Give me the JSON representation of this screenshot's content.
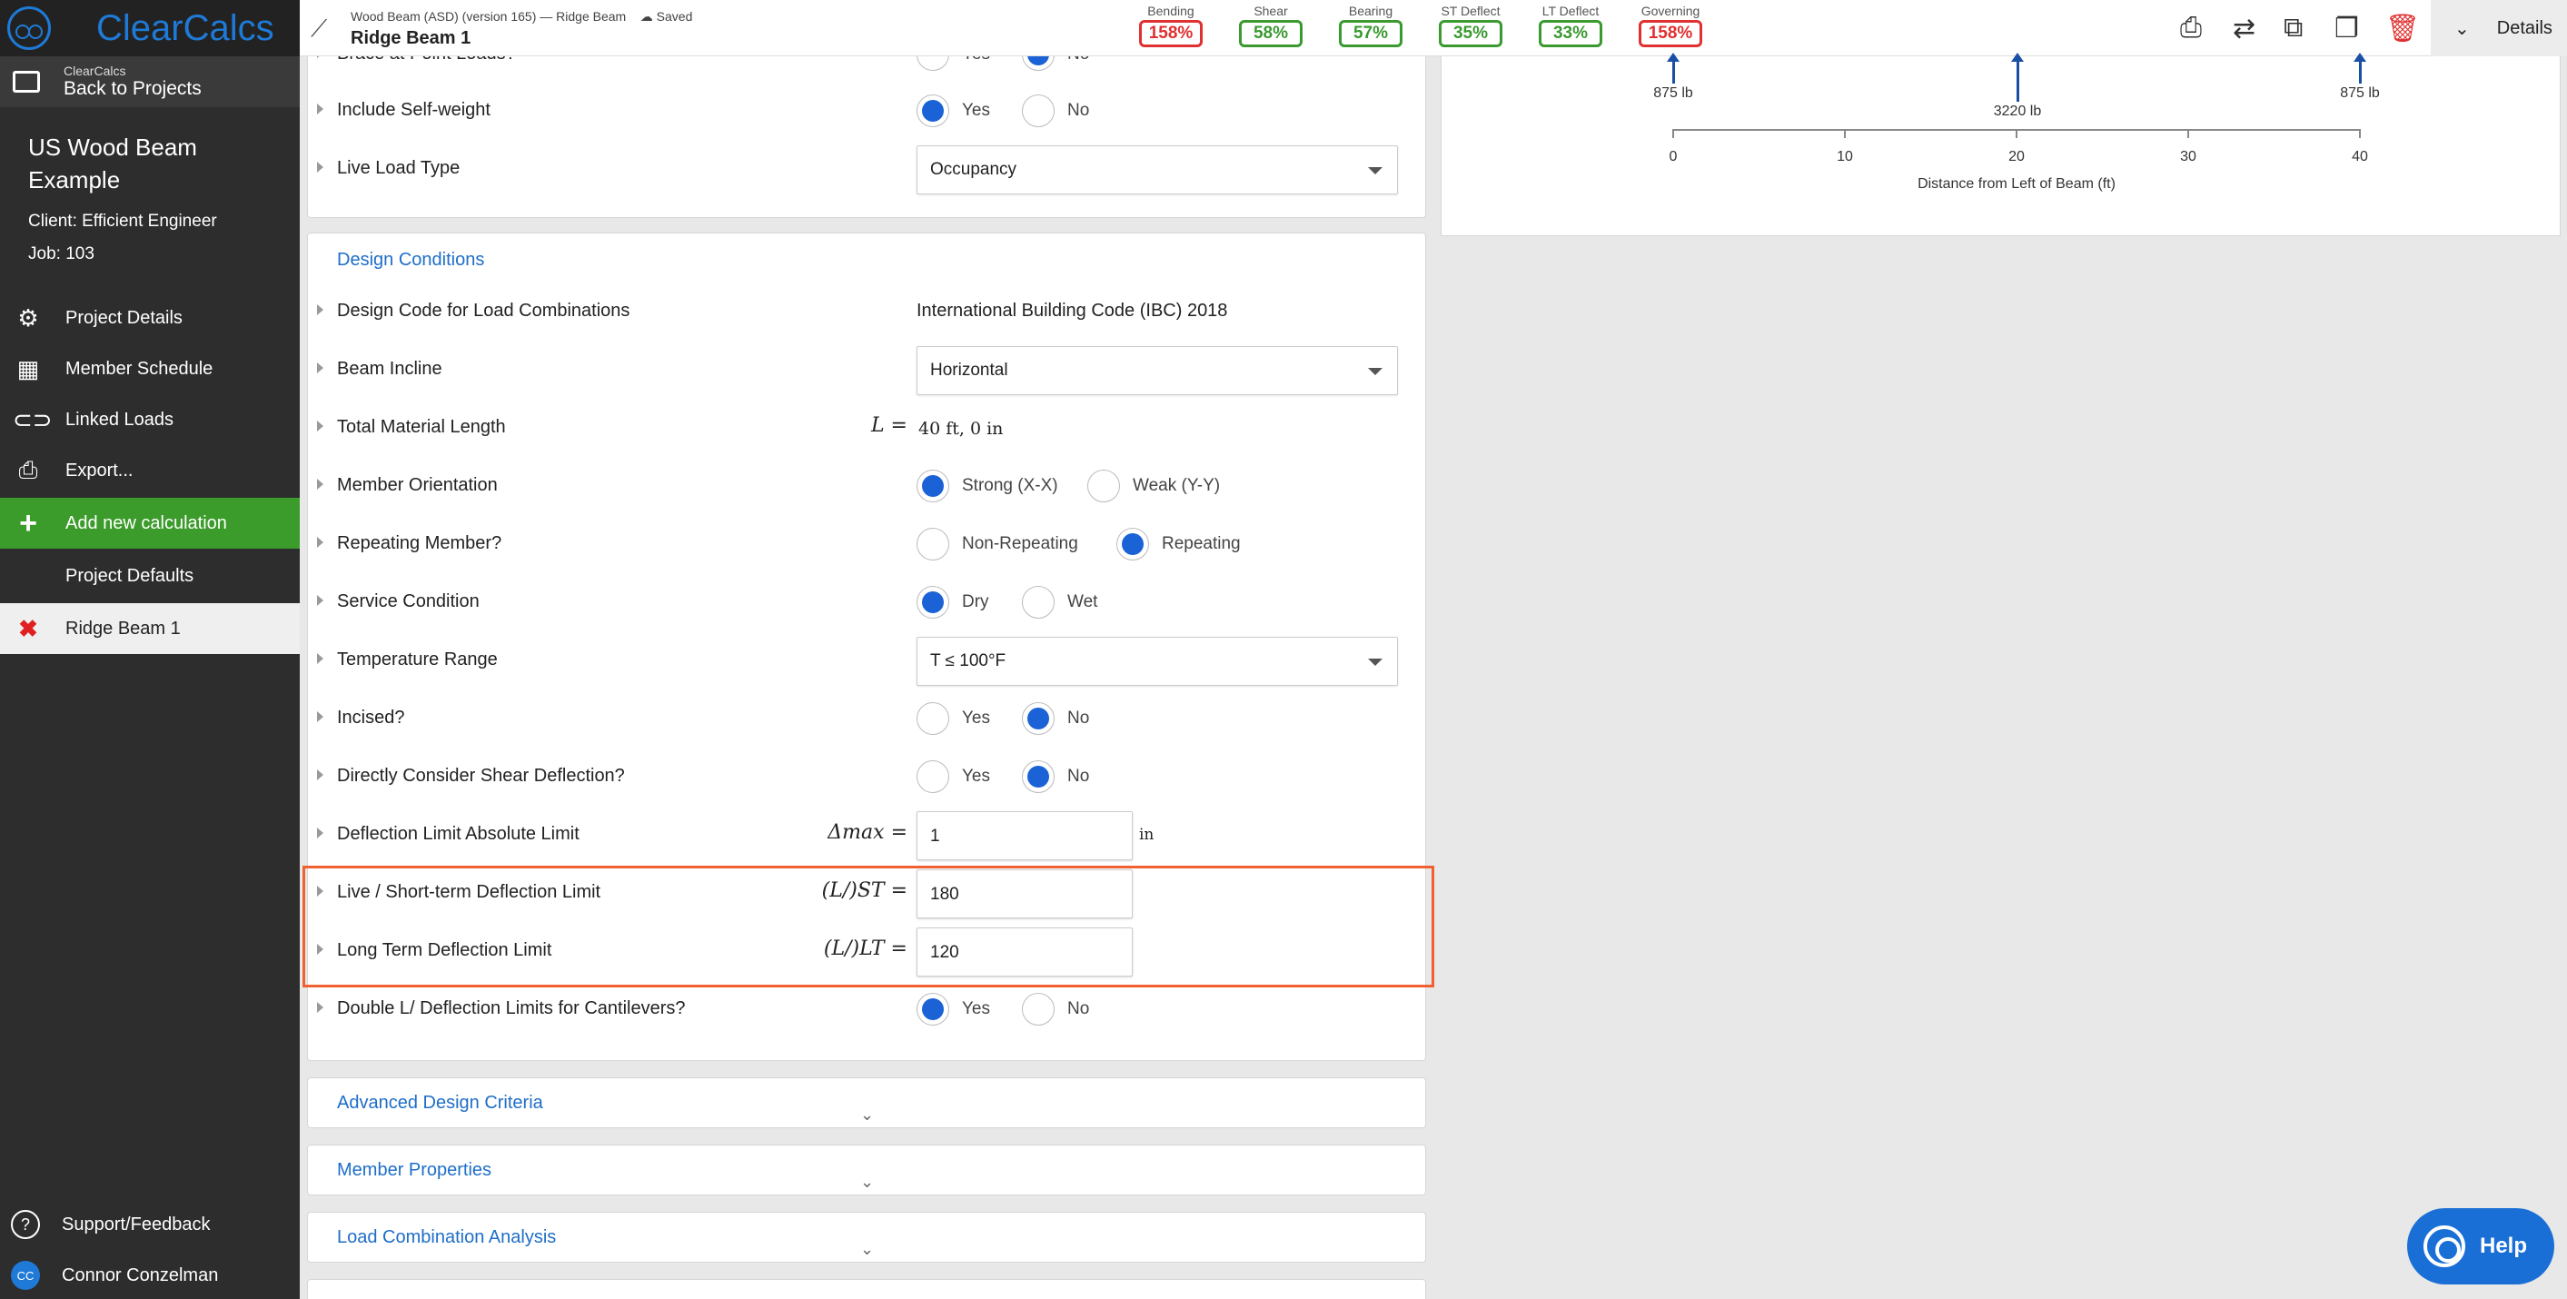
{
  "sidebar": {
    "logo": "ClearCalcs",
    "back_small": "ClearCalcs",
    "back_label": "Back to Projects",
    "project_name": "US Wood Beam Example",
    "client": "Client: Efficient Engineer",
    "job": "Job: 103",
    "nav": [
      "Project Details",
      "Member Schedule",
      "Linked Loads",
      "Export...",
      "Add new calculation",
      "Project Defaults"
    ],
    "current_calc": "Ridge Beam 1",
    "support": "Support/Feedback",
    "user": "Connor Conzelman",
    "user_initials": "CC"
  },
  "header": {
    "subtitle": "Wood Beam (ASD) (version 165) — Ridge Beam",
    "saved": "Saved",
    "title": "Ridge Beam 1",
    "metrics": [
      {
        "label": "Bending",
        "value": "158%",
        "status": "red"
      },
      {
        "label": "Shear",
        "value": "58%",
        "status": "green"
      },
      {
        "label": "Bearing",
        "value": "57%",
        "status": "green"
      },
      {
        "label": "ST Deflect",
        "value": "35%",
        "status": "green"
      },
      {
        "label": "LT Deflect",
        "value": "33%",
        "status": "green"
      },
      {
        "label": "Governing",
        "value": "158%",
        "status": "red"
      }
    ],
    "details": "Details"
  },
  "form": {
    "top_panel": {
      "brace_label": "Brace at Point Loads?",
      "brace_yes": "Yes",
      "brace_no": "No",
      "self_weight_label": "Include Self-weight",
      "self_weight_yes": "Yes",
      "self_weight_no": "No",
      "live_load_label": "Live Load Type",
      "live_load_value": "Occupancy"
    },
    "design_conditions": {
      "title": "Design Conditions",
      "design_code_label": "Design Code for Load Combinations",
      "design_code_value": "International Building Code (IBC) 2018",
      "beam_incline_label": "Beam Incline",
      "beam_incline_value": "Horizontal",
      "length_label": "Total Material Length",
      "length_symbol": "L =",
      "length_value": "40 ft, 0 in",
      "orientation_label": "Member Orientation",
      "orientation_strong": "Strong (X-X)",
      "orientation_weak": "Weak (Y-Y)",
      "repeating_label": "Repeating Member?",
      "repeating_non": "Non-Repeating",
      "repeating_yes": "Repeating",
      "service_label": "Service Condition",
      "service_dry": "Dry",
      "service_wet": "Wet",
      "temp_label": "Temperature Range",
      "temp_value": "T ≤ 100°F",
      "incised_label": "Incised?",
      "incised_yes": "Yes",
      "incised_no": "No",
      "shear_def_label": "Directly Consider Shear Deflection?",
      "shear_def_yes": "Yes",
      "shear_def_no": "No",
      "abs_limit_label": "Deflection Limit Absolute Limit",
      "abs_limit_symbol": "Δmax =",
      "abs_limit_value": "1",
      "abs_limit_unit": "in",
      "st_label": "Live / Short-term Deflection Limit",
      "st_symbol": "(L/)ST =",
      "st_value": "180",
      "lt_label": "Long Term Deflection Limit",
      "lt_symbol": "(L/)LT =",
      "lt_value": "120",
      "double_label": "Double L/ Deflection Limits for Cantilevers?",
      "double_yes": "Yes",
      "double_no": "No"
    },
    "collapsed_sections": [
      "Advanced Design Criteria",
      "Member Properties",
      "Load Combination Analysis"
    ],
    "collapse_glyph": "⌄"
  },
  "diagram": {
    "loads": [
      "875 lb",
      "3220 lb",
      "875 lb"
    ],
    "ticks": [
      "0",
      "10",
      "20",
      "30",
      "40"
    ],
    "xlabel": "Distance from Left of Beam (ft)"
  },
  "help": "Help",
  "colors": {
    "accent": "#1e7ad6",
    "danger": "#e03030",
    "ok": "#3a9a30",
    "highlight": "#f06030"
  }
}
